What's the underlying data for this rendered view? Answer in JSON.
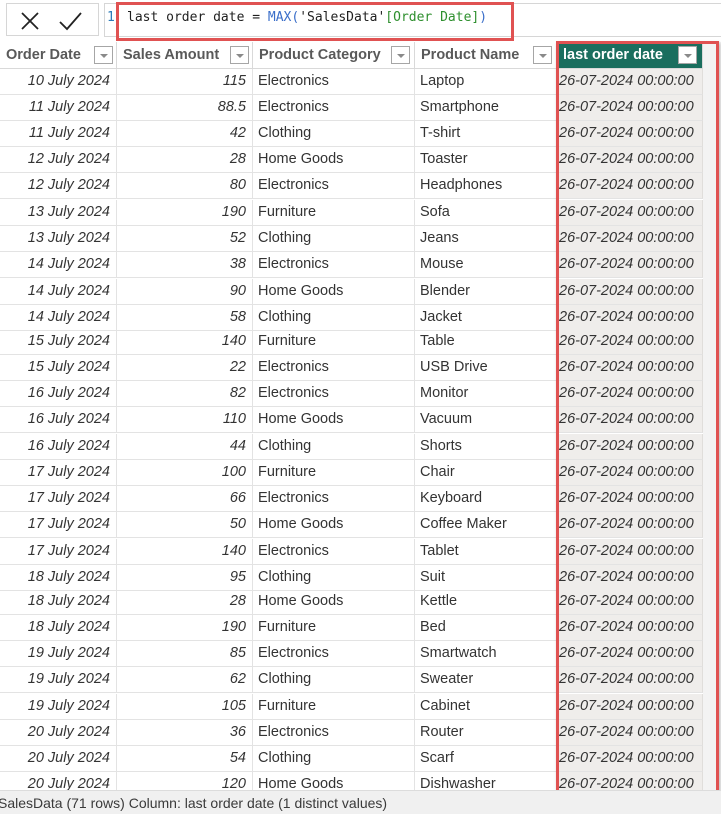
{
  "formula_bar": {
    "cancel_icon": "close-icon",
    "commit_icon": "checkmark-icon",
    "line_number": "1",
    "formula_parts": {
      "name": "last order date = ",
      "function": "MAX(",
      "table": "'SalesData'",
      "column": "[Order Date]",
      "close": ")"
    },
    "full_formula": "last order date = MAX('SalesData'[Order Date])"
  },
  "table": {
    "columns": [
      {
        "key": "order_date",
        "label": "Order Date"
      },
      {
        "key": "sales_amount",
        "label": "Sales Amount"
      },
      {
        "key": "product_category",
        "label": "Product Category"
      },
      {
        "key": "product_name",
        "label": "Product Name"
      },
      {
        "key": "last_order_date",
        "label": "last order date",
        "active": true
      }
    ],
    "rows": [
      {
        "order_date": "10 July 2024",
        "sales_amount": "115",
        "product_category": "Electronics",
        "product_name": "Laptop",
        "last_order_date": "26-07-2024 00:00:00"
      },
      {
        "order_date": "11 July 2024",
        "sales_amount": "88.5",
        "product_category": "Electronics",
        "product_name": "Smartphone",
        "last_order_date": "26-07-2024 00:00:00"
      },
      {
        "order_date": "11 July 2024",
        "sales_amount": "42",
        "product_category": "Clothing",
        "product_name": "T-shirt",
        "last_order_date": "26-07-2024 00:00:00"
      },
      {
        "order_date": "12 July 2024",
        "sales_amount": "28",
        "product_category": "Home Goods",
        "product_name": "Toaster",
        "last_order_date": "26-07-2024 00:00:00"
      },
      {
        "order_date": "12 July 2024",
        "sales_amount": "80",
        "product_category": "Electronics",
        "product_name": "Headphones",
        "last_order_date": "26-07-2024 00:00:00"
      },
      {
        "order_date": "13 July 2024",
        "sales_amount": "190",
        "product_category": "Furniture",
        "product_name": "Sofa",
        "last_order_date": "26-07-2024 00:00:00"
      },
      {
        "order_date": "13 July 2024",
        "sales_amount": "52",
        "product_category": "Clothing",
        "product_name": "Jeans",
        "last_order_date": "26-07-2024 00:00:00"
      },
      {
        "order_date": "14 July 2024",
        "sales_amount": "38",
        "product_category": "Electronics",
        "product_name": "Mouse",
        "last_order_date": "26-07-2024 00:00:00"
      },
      {
        "order_date": "14 July 2024",
        "sales_amount": "90",
        "product_category": "Home Goods",
        "product_name": "Blender",
        "last_order_date": "26-07-2024 00:00:00"
      },
      {
        "order_date": "14 July 2024",
        "sales_amount": "58",
        "product_category": "Clothing",
        "product_name": "Jacket",
        "last_order_date": "26-07-2024 00:00:00"
      },
      {
        "order_date": "15 July 2024",
        "sales_amount": "140",
        "product_category": "Furniture",
        "product_name": "Table",
        "last_order_date": "26-07-2024 00:00:00"
      },
      {
        "order_date": "15 July 2024",
        "sales_amount": "22",
        "product_category": "Electronics",
        "product_name": "USB Drive",
        "last_order_date": "26-07-2024 00:00:00"
      },
      {
        "order_date": "16 July 2024",
        "sales_amount": "82",
        "product_category": "Electronics",
        "product_name": "Monitor",
        "last_order_date": "26-07-2024 00:00:00"
      },
      {
        "order_date": "16 July 2024",
        "sales_amount": "110",
        "product_category": "Home Goods",
        "product_name": "Vacuum",
        "last_order_date": "26-07-2024 00:00:00"
      },
      {
        "order_date": "16 July 2024",
        "sales_amount": "44",
        "product_category": "Clothing",
        "product_name": "Shorts",
        "last_order_date": "26-07-2024 00:00:00"
      },
      {
        "order_date": "17 July 2024",
        "sales_amount": "100",
        "product_category": "Furniture",
        "product_name": "Chair",
        "last_order_date": "26-07-2024 00:00:00"
      },
      {
        "order_date": "17 July 2024",
        "sales_amount": "66",
        "product_category": "Electronics",
        "product_name": "Keyboard",
        "last_order_date": "26-07-2024 00:00:00"
      },
      {
        "order_date": "17 July 2024",
        "sales_amount": "50",
        "product_category": "Home Goods",
        "product_name": "Coffee Maker",
        "last_order_date": "26-07-2024 00:00:00"
      },
      {
        "order_date": "17 July 2024",
        "sales_amount": "140",
        "product_category": "Electronics",
        "product_name": "Tablet",
        "last_order_date": "26-07-2024 00:00:00"
      },
      {
        "order_date": "18 July 2024",
        "sales_amount": "95",
        "product_category": "Clothing",
        "product_name": "Suit",
        "last_order_date": "26-07-2024 00:00:00"
      },
      {
        "order_date": "18 July 2024",
        "sales_amount": "28",
        "product_category": "Home Goods",
        "product_name": "Kettle",
        "last_order_date": "26-07-2024 00:00:00"
      },
      {
        "order_date": "18 July 2024",
        "sales_amount": "190",
        "product_category": "Furniture",
        "product_name": "Bed",
        "last_order_date": "26-07-2024 00:00:00"
      },
      {
        "order_date": "19 July 2024",
        "sales_amount": "85",
        "product_category": "Electronics",
        "product_name": "Smartwatch",
        "last_order_date": "26-07-2024 00:00:00"
      },
      {
        "order_date": "19 July 2024",
        "sales_amount": "62",
        "product_category": "Clothing",
        "product_name": "Sweater",
        "last_order_date": "26-07-2024 00:00:00"
      },
      {
        "order_date": "19 July 2024",
        "sales_amount": "105",
        "product_category": "Furniture",
        "product_name": "Cabinet",
        "last_order_date": "26-07-2024 00:00:00"
      },
      {
        "order_date": "20 July 2024",
        "sales_amount": "36",
        "product_category": "Electronics",
        "product_name": "Router",
        "last_order_date": "26-07-2024 00:00:00"
      },
      {
        "order_date": "20 July 2024",
        "sales_amount": "54",
        "product_category": "Clothing",
        "product_name": "Scarf",
        "last_order_date": "26-07-2024 00:00:00"
      },
      {
        "order_date": "20 July 2024",
        "sales_amount": "120",
        "product_category": "Home Goods",
        "product_name": "Dishwasher",
        "last_order_date": "26-07-2024 00:00:00"
      }
    ]
  },
  "status_bar": {
    "text": "SalesData (71 rows) Column: last order date (1 distinct values)"
  },
  "colors": {
    "active_header": "#1a6e5e",
    "highlight_border": "#e05252",
    "computed_column_bg": "#efedeb",
    "dax_function": "#3a6ec9",
    "dax_bracket": "#2e8f2e"
  }
}
